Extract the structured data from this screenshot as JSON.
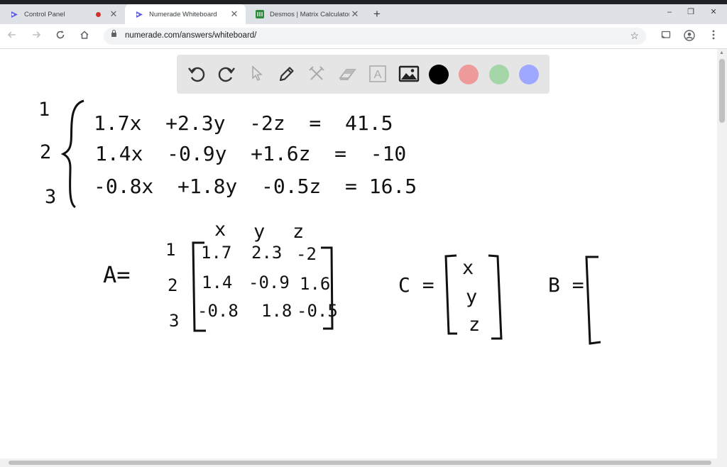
{
  "browser": {
    "tabs": [
      {
        "title": "Control Panel",
        "active": false,
        "recording": true
      },
      {
        "title": "Numerade Whiteboard",
        "active": true,
        "recording": false
      },
      {
        "title": "Desmos | Matrix Calculator",
        "active": false,
        "recording": false
      }
    ],
    "url": "numerade.com/answers/whiteboard/",
    "controls": {
      "close": "✕",
      "new_tab": "+",
      "minimize": "–",
      "maximize": "❐"
    }
  },
  "whiteboard": {
    "tools": [
      "undo-icon",
      "redo-icon",
      "select-icon",
      "pen-icon",
      "tools-icon",
      "eraser-icon",
      "text-icon",
      "image-icon"
    ],
    "text_tool_glyph": "A",
    "colors": [
      "#000000",
      "#ef9a9a",
      "#a5d6a7",
      "#9fa8ff"
    ]
  },
  "handwriting": {
    "equations": [
      {
        "index": "1",
        "text": "1.7x  +2.3y  -2z  =  41.5"
      },
      {
        "index": "2",
        "text": "1.4x  -0.9y  +1.6z  =  -10"
      },
      {
        "index": "3",
        "text": "-0.8x  +1.8y  -0.5z  = 16.5"
      }
    ],
    "matrix_A": {
      "label": "A=",
      "col_headers": [
        "x",
        "y",
        "z"
      ],
      "row_labels": [
        "1",
        "2",
        "3"
      ],
      "rows": [
        [
          "1.7",
          "2.3",
          "-2"
        ],
        [
          "1.4",
          "-0.9",
          "1.6"
        ],
        [
          "-0.8",
          "1.8",
          "-0.5"
        ]
      ]
    },
    "matrix_C": {
      "label": "C =",
      "entries": [
        "x",
        "y",
        "z"
      ]
    },
    "matrix_B": {
      "label": "B ="
    }
  }
}
